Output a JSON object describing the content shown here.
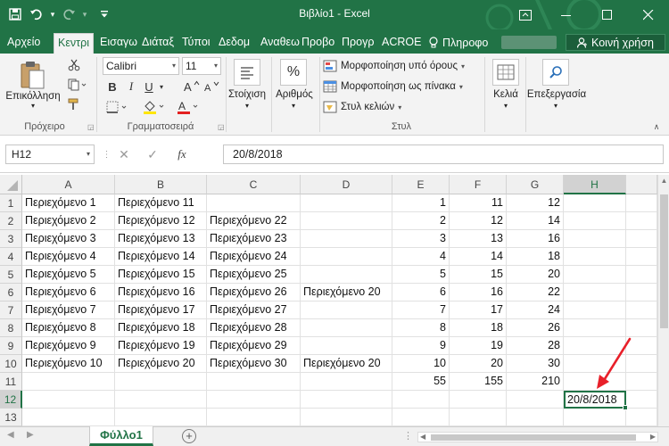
{
  "window": {
    "title": "Βιβλίο1 - Excel"
  },
  "tabs": [
    "Αρχείο",
    "Κεντρι",
    "Εισαγω",
    "Διάταξ",
    "Τύποι",
    "Δεδομ",
    "Αναθεω",
    "Προβο",
    "Προγρ",
    "ACROE"
  ],
  "active_tab_index": 1,
  "tell_me": "Πληροφο",
  "share_label": "Κοινή χρήση",
  "ribbon": {
    "clipboard": {
      "paste_label": "Επικόλληση",
      "group_label": "Πρόχειρο"
    },
    "font": {
      "font_name": "Calibri",
      "font_size": "11",
      "group_label": "Γραμματοσειρά",
      "bold": "B",
      "italic": "I",
      "underline": "U"
    },
    "alignment": {
      "label": "Στοίχιση"
    },
    "number": {
      "label": "Αριθμός"
    },
    "styles": {
      "conditional": "Μορφοποίηση υπό όρους",
      "table": "Μορφοποίηση ως πίνακα",
      "cell_styles": "Στυλ κελιών",
      "group_label": "Στυλ"
    },
    "cells": {
      "label": "Κελιά"
    },
    "editing": {
      "label": "Επεξεργασία"
    }
  },
  "formula_bar": {
    "name_box": "H12",
    "cancel": "✕",
    "enter": "✓",
    "fx": "fx",
    "formula": "20/8/2018"
  },
  "grid": {
    "columns": [
      "A",
      "B",
      "C",
      "D",
      "E",
      "F",
      "G",
      "H"
    ],
    "selected_column": "H",
    "rows": [
      [
        "Περιεχόμενο 1",
        "Περιεχόμενο 11",
        "",
        "",
        "1",
        "11",
        "12",
        ""
      ],
      [
        "Περιεχόμενο 2",
        "Περιεχόμενο 12",
        "Περιεχόμενο 22",
        "",
        "2",
        "12",
        "14",
        ""
      ],
      [
        "Περιεχόμενο 3",
        "Περιεχόμενο 13",
        "Περιεχόμενο 23",
        "",
        "3",
        "13",
        "16",
        ""
      ],
      [
        "Περιεχόμενο 4",
        "Περιεχόμενο 14",
        "Περιεχόμενο 24",
        "",
        "4",
        "14",
        "18",
        ""
      ],
      [
        "Περιεχόμενο 5",
        "Περιεχόμενο 15",
        "Περιεχόμενο 25",
        "",
        "5",
        "15",
        "20",
        ""
      ],
      [
        "Περιεχόμενο 6",
        "Περιεχόμενο 16",
        "Περιεχόμενο 26",
        "Περιεχόμενο 20",
        "6",
        "16",
        "22",
        ""
      ],
      [
        "Περιεχόμενο 7",
        "Περιεχόμενο 17",
        "Περιεχόμενο 27",
        "",
        "7",
        "17",
        "24",
        ""
      ],
      [
        "Περιεχόμενο 8",
        "Περιεχόμενο 18",
        "Περιεχόμενο 28",
        "",
        "8",
        "18",
        "26",
        ""
      ],
      [
        "Περιεχόμενο 9",
        "Περιεχόμενο 19",
        "Περιεχόμενο 29",
        "",
        "9",
        "19",
        "28",
        ""
      ],
      [
        "Περιεχόμενο 10",
        "Περιεχόμενο 20",
        "Περιεχόμενο 30",
        "Περιεχόμενο 20",
        "10",
        "20",
        "30",
        ""
      ],
      [
        "",
        "",
        "",
        "",
        "55",
        "155",
        "210",
        ""
      ],
      [
        "",
        "",
        "",
        "",
        "",
        "",
        "",
        "20/8/2018"
      ]
    ],
    "row_numbers": [
      "1",
      "2",
      "3",
      "4",
      "5",
      "6",
      "7",
      "8",
      "9",
      "10",
      "11",
      "12",
      "13"
    ],
    "numeric_columns": [
      4,
      5,
      6
    ],
    "active_cell": {
      "row": 12,
      "col": "H"
    }
  },
  "sheets": [
    "Φύλλο1"
  ],
  "add_sheet": "+",
  "colors": {
    "excel_green": "#217346",
    "arrow_red": "#e8202a"
  }
}
